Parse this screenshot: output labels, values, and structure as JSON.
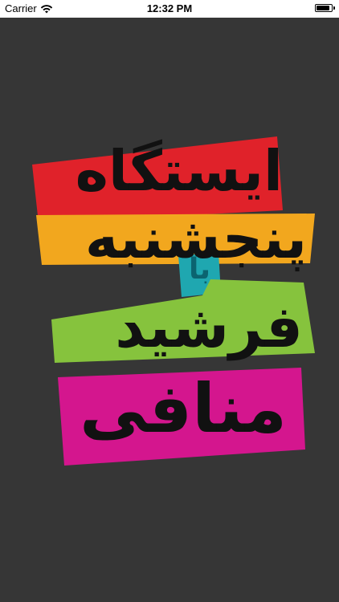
{
  "status_bar": {
    "carrier": "Carrier",
    "time": "12:32 PM",
    "wifi_icon": "wifi-icon",
    "battery_icon": "battery-icon"
  },
  "logo": {
    "lines": [
      {
        "text": "ایستگاه",
        "color": "#e0222a"
      },
      {
        "text": "پنجشنبه",
        "color": "#f2a71e"
      },
      {
        "text": "با",
        "color": "#1fa7b0"
      },
      {
        "text": "فرشید",
        "color": "#86c33d"
      },
      {
        "text": "منافی",
        "color": "#d4168e"
      }
    ],
    "background": "#363636"
  }
}
